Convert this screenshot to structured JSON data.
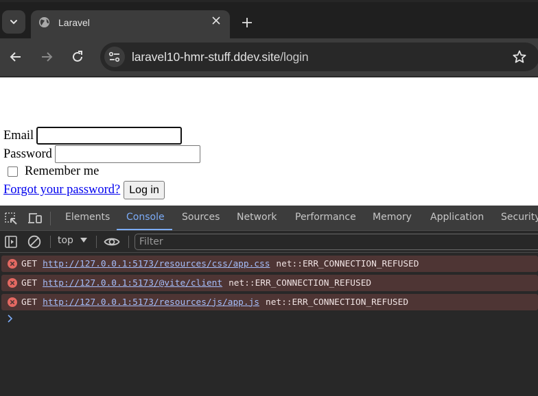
{
  "browser": {
    "tab": {
      "title": "Laravel",
      "favicon": "globe-icon"
    },
    "new_tab_icon": "plus-icon",
    "address_bar": {
      "host": "laravel10-hmr-stuff.ddev.site",
      "path": "/login"
    },
    "icons": {
      "back": "arrow-left-icon",
      "forward": "arrow-right-icon",
      "reload": "reload-icon",
      "site_info": "tune-icon",
      "bookmark": "star-icon"
    }
  },
  "page": {
    "email_label": "Email",
    "email_value": "",
    "password_label": "Password",
    "password_value": "",
    "remember_label": "Remember me",
    "remember_checked": false,
    "forgot_link": "Forgot your password?",
    "login_button": "Log in"
  },
  "devtools": {
    "tabs": [
      {
        "label": "Elements",
        "active": false
      },
      {
        "label": "Console",
        "active": true
      },
      {
        "label": "Sources",
        "active": false
      },
      {
        "label": "Network",
        "active": false
      },
      {
        "label": "Performance",
        "active": false
      },
      {
        "label": "Memory",
        "active": false
      },
      {
        "label": "Application",
        "active": false
      },
      {
        "label": "Security",
        "active": false
      }
    ],
    "console_toolbar": {
      "context": "top",
      "filter_placeholder": "Filter"
    },
    "messages": [
      {
        "level": "error",
        "method": "GET",
        "url": "http://127.0.0.1:5173/resources/css/app.css",
        "error": "net::ERR_CONNECTION_REFUSED"
      },
      {
        "level": "error",
        "method": "GET",
        "url": "http://127.0.0.1:5173/@vite/client",
        "error": "net::ERR_CONNECTION_REFUSED"
      },
      {
        "level": "error",
        "method": "GET",
        "url": "http://127.0.0.1:5173/resources/js/app.js",
        "error": "net::ERR_CONNECTION_REFUSED"
      }
    ],
    "colors": {
      "accent": "#7cacf8",
      "error_bg": "#4e3534",
      "error_icon": "#e46962",
      "link": "#a6bffc"
    }
  }
}
